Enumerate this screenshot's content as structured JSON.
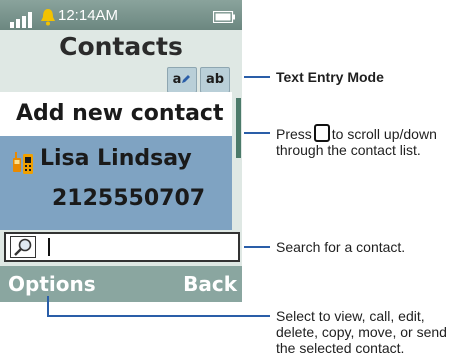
{
  "status": {
    "time": "12:14AM"
  },
  "screen": {
    "title": "Contacts",
    "text_mode_buttons": [
      "a",
      "ab"
    ],
    "add_contact_label": "Add new contact",
    "contact": {
      "name": "Lisa Lindsay",
      "number": "2125550707"
    },
    "search": {
      "value": ""
    },
    "softkeys": {
      "left": "Options",
      "right": "Back"
    }
  },
  "callouts": {
    "text_entry_mode": "Text Entry Mode",
    "scroll_prefix": "Press",
    "scroll_suffix": "to scroll up/down",
    "scroll_line2": "through the contact list.",
    "search_hint": "Search for a contact.",
    "options_line1": "Select to view, call, edit,",
    "options_line2": "delete, copy, move, or send",
    "options_line3": "the selected contact."
  },
  "colors": {
    "accent_blue": "#2a5ea8",
    "highlight_row": "#7fa3c2",
    "status_bar": "#7c958e"
  },
  "icons": {
    "signal": "signal-bars-icon",
    "alert": "bell-icon",
    "battery": "battery-icon",
    "contact": "phone-contact-icon",
    "search": "magnifier-icon",
    "nav": "navigation-key-icon"
  }
}
